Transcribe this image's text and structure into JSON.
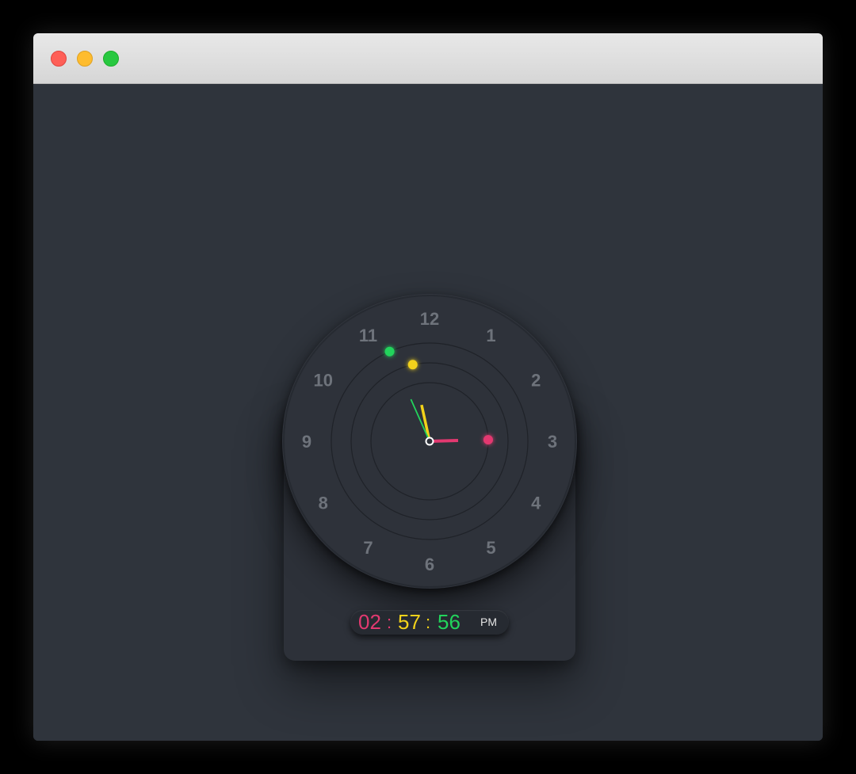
{
  "window": {
    "controls": [
      "close",
      "minimize",
      "maximize"
    ]
  },
  "clock": {
    "numerals": [
      "12",
      "1",
      "2",
      "3",
      "4",
      "5",
      "6",
      "7",
      "8",
      "9",
      "10",
      "11"
    ],
    "time": {
      "hour": 2,
      "minute": 57,
      "second": 56
    },
    "colors": {
      "hour": "#e33970",
      "minute": "#f2d21a",
      "second": "#22d45c",
      "numeral": "#6e737b"
    },
    "digital": {
      "hours": "02",
      "separator1": ":",
      "minutes": "57",
      "separator2": ":",
      "seconds": "56",
      "ampm": "PM"
    }
  }
}
